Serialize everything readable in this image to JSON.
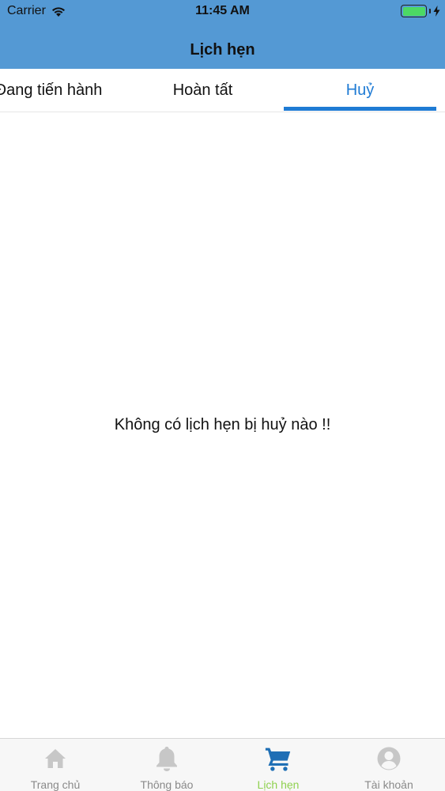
{
  "status_bar": {
    "carrier": "Carrier",
    "time": "11:45 AM",
    "battery_level": 1.0,
    "icons": [
      "wifi-icon",
      "battery-icon",
      "charging-icon"
    ]
  },
  "header": {
    "title": "Lịch hẹn",
    "color": "#5499d4"
  },
  "tabs": [
    {
      "label": "Đang tiến hành",
      "selected": false
    },
    {
      "label": "Hoàn tất",
      "selected": false
    },
    {
      "label": "Huỷ",
      "selected": true
    }
  ],
  "accent_color": "#1f7bd4",
  "main": {
    "empty_message": "Không có lịch hẹn bị huỷ nào !!"
  },
  "bottom_nav": {
    "items": [
      {
        "label": "Trang chủ",
        "icon": "home-icon",
        "active": false
      },
      {
        "label": "Thông báo",
        "icon": "bell-icon",
        "active": false
      },
      {
        "label": "Lịch hẹn",
        "icon": "cart-icon",
        "active": true
      },
      {
        "label": "Tài khoản",
        "icon": "account-icon",
        "active": false
      }
    ],
    "active_color": "#8fd14f",
    "inactive_color": "#c7c7c7"
  }
}
